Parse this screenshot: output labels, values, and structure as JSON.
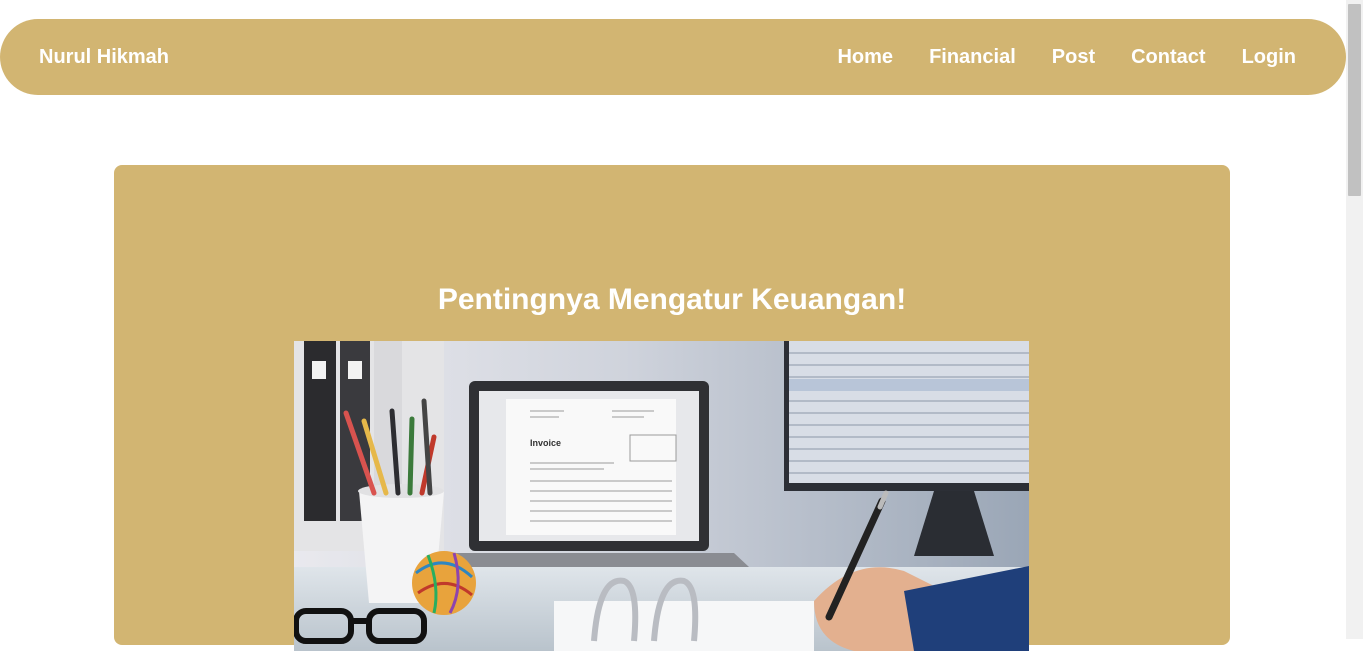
{
  "navbar": {
    "brand": "Nurul Hikmah",
    "links": [
      "Home",
      "Financial",
      "Post",
      "Contact",
      "Login"
    ]
  },
  "post": {
    "title": "Pentingnya Mengatur Keuangan!",
    "image": {
      "invoice_heading": "Invoice"
    }
  },
  "colors": {
    "accent": "#d2b572",
    "text_on_accent": "#ffffff"
  }
}
